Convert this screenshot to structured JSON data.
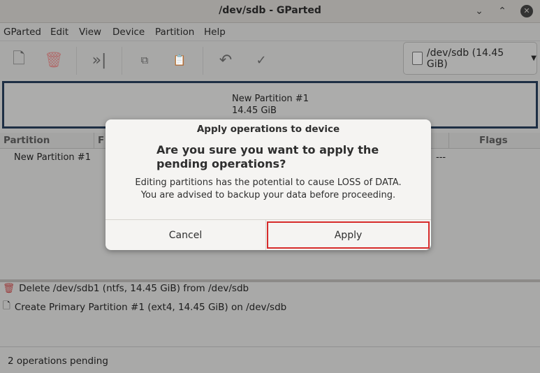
{
  "window": {
    "title": "/dev/sdb - GParted"
  },
  "menu": [
    "GParted",
    "Edit",
    "View",
    "Device",
    "Partition",
    "Help"
  ],
  "device_selector": {
    "label": "/dev/sdb (14.45 GiB)"
  },
  "disk_map": {
    "name": "New Partition #1",
    "size": "14.45 GiB"
  },
  "table": {
    "headers": {
      "partition": "Partition",
      "fs": "F",
      "flags": "Flags"
    },
    "rows": [
      {
        "partition": "New Partition #1",
        "flags": "---"
      }
    ]
  },
  "operations": [
    "Delete /dev/sdb1 (ntfs, 14.45 GiB) from /dev/sdb",
    "Create Primary Partition #1 (ext4, 14.45 GiB) on /dev/sdb"
  ],
  "status": "2 operations pending",
  "dialog": {
    "title": "Apply operations to device",
    "heading": "Are you sure you want to apply the pending operations?",
    "line1": "Editing partitions has the potential to cause LOSS of DATA.",
    "line2": "You are advised to backup your data before proceeding.",
    "cancel": "Cancel",
    "apply": "Apply"
  }
}
